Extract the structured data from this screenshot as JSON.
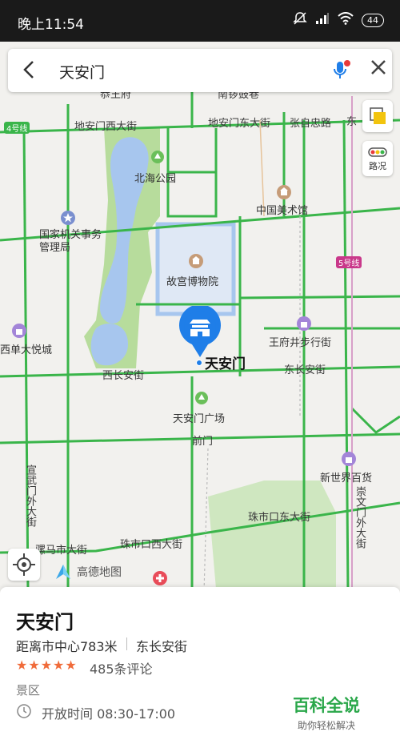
{
  "status_bar": {
    "time": "晚上11:54",
    "battery": "44"
  },
  "search": {
    "query": "天安门"
  },
  "buttons": {
    "traffic_label": "路况"
  },
  "map": {
    "roads": {
      "dianmen_west": "地安门西大街",
      "dianmen_east": "地安门东大街",
      "zhangzizhong": "张自忠路",
      "dong": "东",
      "xichangan": "西长安街",
      "dongchangan": "东长安街",
      "wangfujing": "王府井步行街",
      "qianmen": "前门",
      "xuanwumen": "宣武门外大街",
      "zhushikou_east": "珠市口东大街",
      "zhushikou_west": "珠市口西大街",
      "luomashi": "骡马市大街",
      "chongwenmen": "崇文门外大街",
      "nanluoguxiang": "南锣鼓巷",
      "gongwangfu": "恭王府"
    },
    "pois": {
      "beihai": "北海公园",
      "meishuguan": "中国美术馆",
      "jiguan": "国家机关事务管理局",
      "gugong": "故宫博物院",
      "xidan": "西单大悦城",
      "tiananmen": "天安门",
      "guangchang": "天安门广场",
      "xinshijie": "新世界百货"
    },
    "subway": {
      "line4": "4号线",
      "line5": "5号线"
    },
    "logo": "高德地图"
  },
  "place": {
    "name": "天安门",
    "distance": "距离市中心783米",
    "street": "东长安街",
    "rating": "★★★★★",
    "reviews": "485条评论",
    "category": "景区",
    "hours": "开放时间 08:30-17:00"
  },
  "watermark": {
    "main": "百科全说",
    "sub": "助你轻松解决"
  },
  "colors": {
    "road": "#3ab54a",
    "water": "#a7c6ee",
    "green": "#b7dc9c",
    "accent": "#1f7ee8",
    "star": "#f06b3a"
  }
}
